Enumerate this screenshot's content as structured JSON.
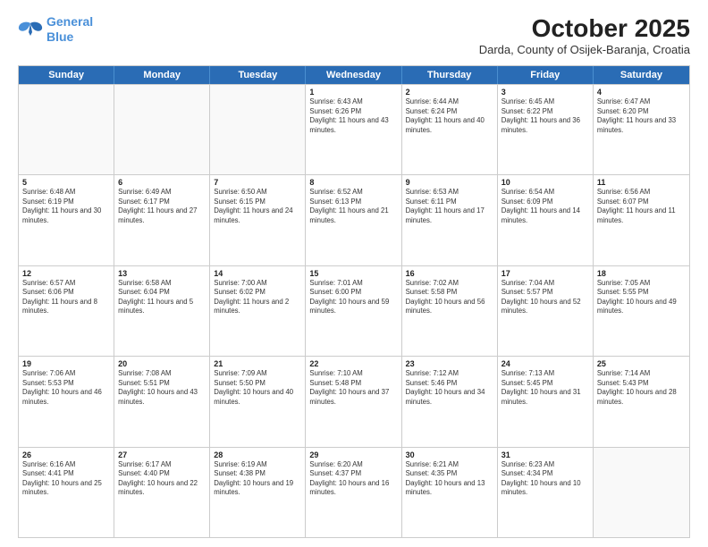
{
  "header": {
    "logo_line1": "General",
    "logo_line2": "Blue",
    "month": "October 2025",
    "location": "Darda, County of Osijek-Baranja, Croatia"
  },
  "weekdays": [
    "Sunday",
    "Monday",
    "Tuesday",
    "Wednesday",
    "Thursday",
    "Friday",
    "Saturday"
  ],
  "rows": [
    [
      {
        "day": "",
        "sunrise": "",
        "sunset": "",
        "daylight": ""
      },
      {
        "day": "",
        "sunrise": "",
        "sunset": "",
        "daylight": ""
      },
      {
        "day": "",
        "sunrise": "",
        "sunset": "",
        "daylight": ""
      },
      {
        "day": "1",
        "sunrise": "Sunrise: 6:43 AM",
        "sunset": "Sunset: 6:26 PM",
        "daylight": "Daylight: 11 hours and 43 minutes."
      },
      {
        "day": "2",
        "sunrise": "Sunrise: 6:44 AM",
        "sunset": "Sunset: 6:24 PM",
        "daylight": "Daylight: 11 hours and 40 minutes."
      },
      {
        "day": "3",
        "sunrise": "Sunrise: 6:45 AM",
        "sunset": "Sunset: 6:22 PM",
        "daylight": "Daylight: 11 hours and 36 minutes."
      },
      {
        "day": "4",
        "sunrise": "Sunrise: 6:47 AM",
        "sunset": "Sunset: 6:20 PM",
        "daylight": "Daylight: 11 hours and 33 minutes."
      }
    ],
    [
      {
        "day": "5",
        "sunrise": "Sunrise: 6:48 AM",
        "sunset": "Sunset: 6:19 PM",
        "daylight": "Daylight: 11 hours and 30 minutes."
      },
      {
        "day": "6",
        "sunrise": "Sunrise: 6:49 AM",
        "sunset": "Sunset: 6:17 PM",
        "daylight": "Daylight: 11 hours and 27 minutes."
      },
      {
        "day": "7",
        "sunrise": "Sunrise: 6:50 AM",
        "sunset": "Sunset: 6:15 PM",
        "daylight": "Daylight: 11 hours and 24 minutes."
      },
      {
        "day": "8",
        "sunrise": "Sunrise: 6:52 AM",
        "sunset": "Sunset: 6:13 PM",
        "daylight": "Daylight: 11 hours and 21 minutes."
      },
      {
        "day": "9",
        "sunrise": "Sunrise: 6:53 AM",
        "sunset": "Sunset: 6:11 PM",
        "daylight": "Daylight: 11 hours and 17 minutes."
      },
      {
        "day": "10",
        "sunrise": "Sunrise: 6:54 AM",
        "sunset": "Sunset: 6:09 PM",
        "daylight": "Daylight: 11 hours and 14 minutes."
      },
      {
        "day": "11",
        "sunrise": "Sunrise: 6:56 AM",
        "sunset": "Sunset: 6:07 PM",
        "daylight": "Daylight: 11 hours and 11 minutes."
      }
    ],
    [
      {
        "day": "12",
        "sunrise": "Sunrise: 6:57 AM",
        "sunset": "Sunset: 6:06 PM",
        "daylight": "Daylight: 11 hours and 8 minutes."
      },
      {
        "day": "13",
        "sunrise": "Sunrise: 6:58 AM",
        "sunset": "Sunset: 6:04 PM",
        "daylight": "Daylight: 11 hours and 5 minutes."
      },
      {
        "day": "14",
        "sunrise": "Sunrise: 7:00 AM",
        "sunset": "Sunset: 6:02 PM",
        "daylight": "Daylight: 11 hours and 2 minutes."
      },
      {
        "day": "15",
        "sunrise": "Sunrise: 7:01 AM",
        "sunset": "Sunset: 6:00 PM",
        "daylight": "Daylight: 10 hours and 59 minutes."
      },
      {
        "day": "16",
        "sunrise": "Sunrise: 7:02 AM",
        "sunset": "Sunset: 5:58 PM",
        "daylight": "Daylight: 10 hours and 56 minutes."
      },
      {
        "day": "17",
        "sunrise": "Sunrise: 7:04 AM",
        "sunset": "Sunset: 5:57 PM",
        "daylight": "Daylight: 10 hours and 52 minutes."
      },
      {
        "day": "18",
        "sunrise": "Sunrise: 7:05 AM",
        "sunset": "Sunset: 5:55 PM",
        "daylight": "Daylight: 10 hours and 49 minutes."
      }
    ],
    [
      {
        "day": "19",
        "sunrise": "Sunrise: 7:06 AM",
        "sunset": "Sunset: 5:53 PM",
        "daylight": "Daylight: 10 hours and 46 minutes."
      },
      {
        "day": "20",
        "sunrise": "Sunrise: 7:08 AM",
        "sunset": "Sunset: 5:51 PM",
        "daylight": "Daylight: 10 hours and 43 minutes."
      },
      {
        "day": "21",
        "sunrise": "Sunrise: 7:09 AM",
        "sunset": "Sunset: 5:50 PM",
        "daylight": "Daylight: 10 hours and 40 minutes."
      },
      {
        "day": "22",
        "sunrise": "Sunrise: 7:10 AM",
        "sunset": "Sunset: 5:48 PM",
        "daylight": "Daylight: 10 hours and 37 minutes."
      },
      {
        "day": "23",
        "sunrise": "Sunrise: 7:12 AM",
        "sunset": "Sunset: 5:46 PM",
        "daylight": "Daylight: 10 hours and 34 minutes."
      },
      {
        "day": "24",
        "sunrise": "Sunrise: 7:13 AM",
        "sunset": "Sunset: 5:45 PM",
        "daylight": "Daylight: 10 hours and 31 minutes."
      },
      {
        "day": "25",
        "sunrise": "Sunrise: 7:14 AM",
        "sunset": "Sunset: 5:43 PM",
        "daylight": "Daylight: 10 hours and 28 minutes."
      }
    ],
    [
      {
        "day": "26",
        "sunrise": "Sunrise: 6:16 AM",
        "sunset": "Sunset: 4:41 PM",
        "daylight": "Daylight: 10 hours and 25 minutes."
      },
      {
        "day": "27",
        "sunrise": "Sunrise: 6:17 AM",
        "sunset": "Sunset: 4:40 PM",
        "daylight": "Daylight: 10 hours and 22 minutes."
      },
      {
        "day": "28",
        "sunrise": "Sunrise: 6:19 AM",
        "sunset": "Sunset: 4:38 PM",
        "daylight": "Daylight: 10 hours and 19 minutes."
      },
      {
        "day": "29",
        "sunrise": "Sunrise: 6:20 AM",
        "sunset": "Sunset: 4:37 PM",
        "daylight": "Daylight: 10 hours and 16 minutes."
      },
      {
        "day": "30",
        "sunrise": "Sunrise: 6:21 AM",
        "sunset": "Sunset: 4:35 PM",
        "daylight": "Daylight: 10 hours and 13 minutes."
      },
      {
        "day": "31",
        "sunrise": "Sunrise: 6:23 AM",
        "sunset": "Sunset: 4:34 PM",
        "daylight": "Daylight: 10 hours and 10 minutes."
      },
      {
        "day": "",
        "sunrise": "",
        "sunset": "",
        "daylight": ""
      }
    ]
  ]
}
